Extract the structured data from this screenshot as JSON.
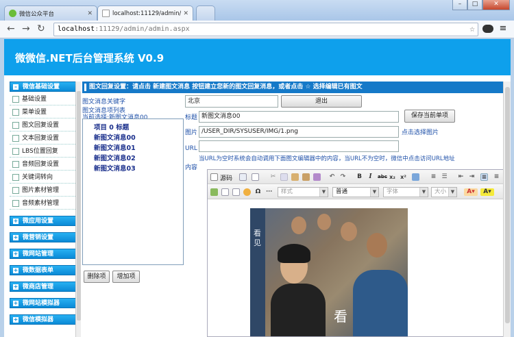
{
  "browser": {
    "tab_inactive_title": "微信公众平台",
    "tab_active_title": "localhost:11129/admin/a",
    "address_host": "localhost",
    "address_path": ":11129/admin/admin.aspx"
  },
  "banner": {
    "title": "微微信.NET后台管理系统 V0.9"
  },
  "sidebar": {
    "sections": [
      {
        "label": "微信基础设置",
        "expanded": true
      },
      {
        "label": "微应用设置"
      },
      {
        "label": "微营销设置"
      },
      {
        "label": "微网站管理"
      },
      {
        "label": "微数据表单"
      },
      {
        "label": "微商店管理"
      },
      {
        "label": "微网站模拟器"
      },
      {
        "label": "微信模拟器"
      }
    ],
    "items": [
      "基础设置",
      "菜单设置",
      "图文回复设置",
      "文本回复设置",
      "LBS位置回复",
      "音频回复设置",
      "关键词转向",
      "图片素材管理",
      "音频素材管理"
    ]
  },
  "main": {
    "hint": "图文回复设置：请点击 新建图文消息 按钮建立您新的图文回复消息，或者点击 ☆ 选择编辑已有图文",
    "keyword_label": "图文消息关键字",
    "keyword_value": "北京",
    "list_label": "图文消息项列表",
    "current_label": "当前选择:新图文消息00",
    "tree": [
      "项目 0 标题",
      "新图文消息00",
      "新图文消息01",
      "新图文消息02",
      "新图文消息03"
    ],
    "exit_button": "退出",
    "title_label": "标题",
    "title_value": "新图文消息00",
    "save_button": "保存当前单项",
    "image_label": "图片",
    "image_value": "/USER_DIR/SYSUSER/IMG/1.png",
    "image_link": "点击选择图片",
    "url_label": "URL",
    "url_hint": "当URL为空时系统会自动调用下面图文编辑器中的内容，当URL不为空时，微信中点击访问URL地址",
    "content_label": "内容",
    "delete_button": "删除项",
    "add_button": "增加项"
  },
  "editor": {
    "source_label": "源码",
    "style_placeholder": "样式",
    "format_value": "普通",
    "font_placeholder": "字体",
    "size_placeholder": "大小",
    "photo_text_vertical": "看见",
    "photo_text_big": "看"
  }
}
